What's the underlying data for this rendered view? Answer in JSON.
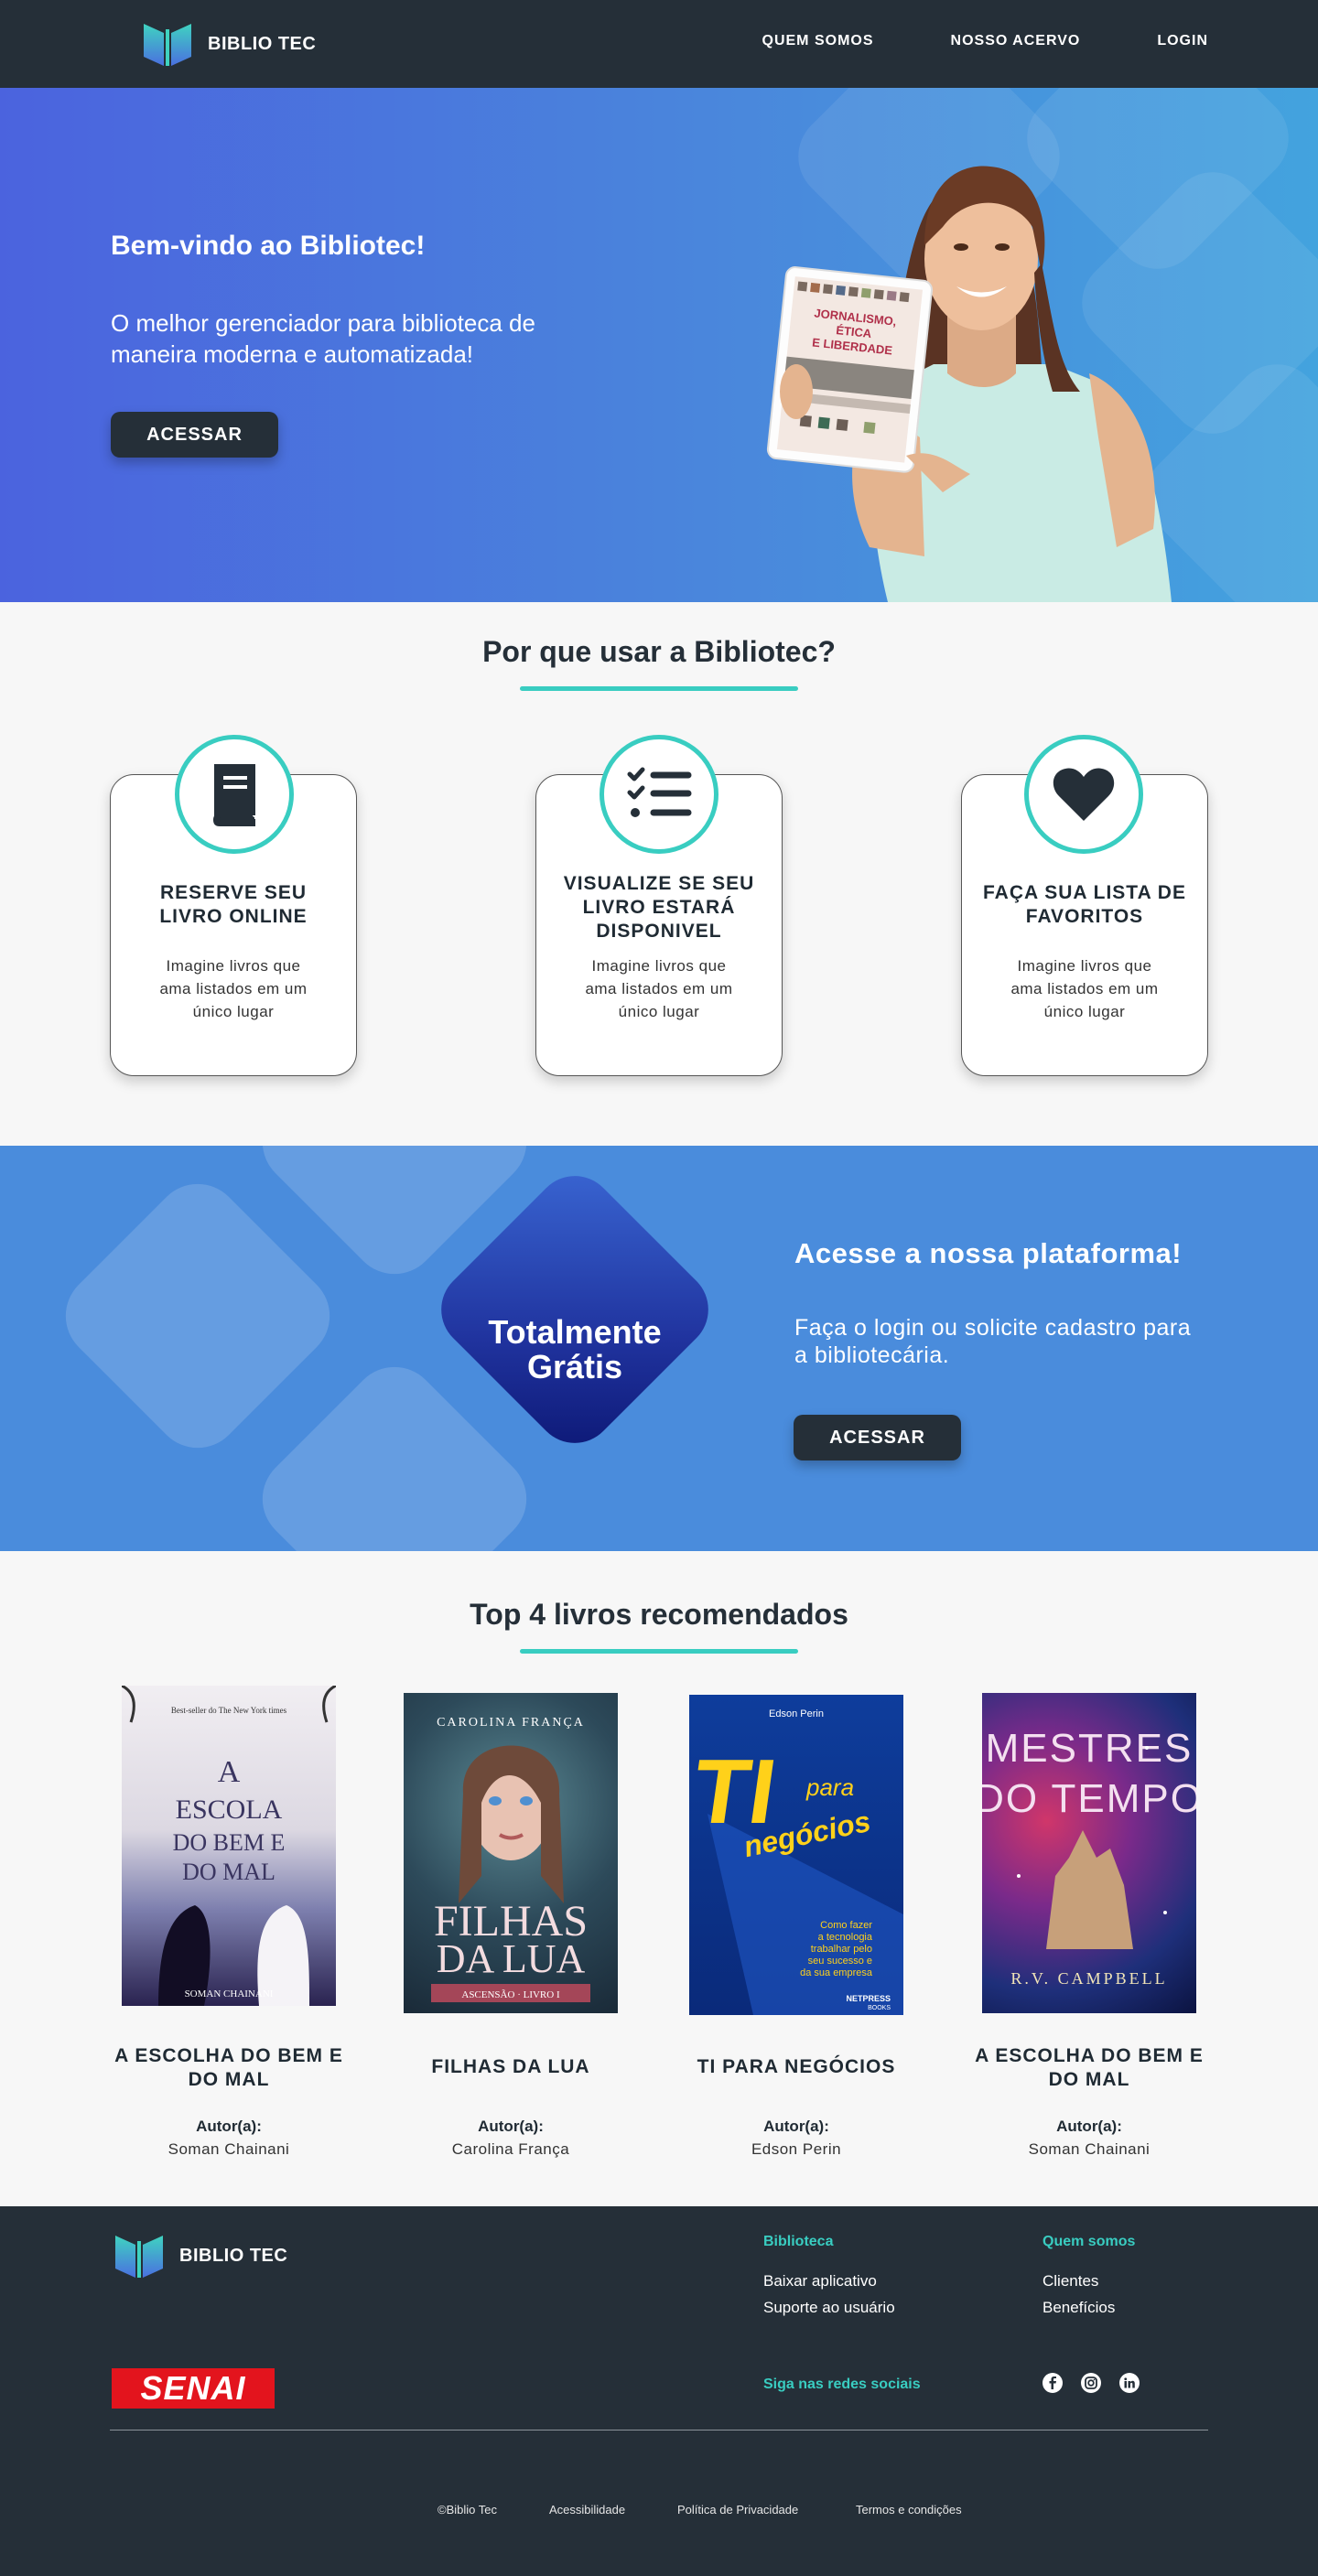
{
  "nav": {
    "logo_text": "BIBLIO TEC",
    "links": [
      "QUEM SOMOS",
      "NOSSO ACERVO",
      "LOGIN"
    ]
  },
  "hero": {
    "title": "Bem-vindo ao Bibliotec!",
    "subtitle": "O melhor gerenciador para biblioteca de maneira moderna e automatizada!",
    "button": "ACESSAR",
    "tablet_book": "JORNALISMO, ÉTICA E LIBERDADE"
  },
  "why": {
    "title": "Por que usar a Bibliotec?",
    "cards": [
      {
        "icon": "book-icon",
        "title": "RESERVE SEU LIVRO ONLINE",
        "text": "Imagine livros que ama listados em um único lugar"
      },
      {
        "icon": "checklist-icon",
        "title": "VISUALIZE SE SEU LIVRO ESTARÁ DISPONIVEL",
        "text": "Imagine livros que ama listados em um único lugar"
      },
      {
        "icon": "heart-icon",
        "title": "FAÇA SUA LISTA DE FAVORITOS",
        "text": "Imagine livros que ama listados em um único lugar"
      }
    ]
  },
  "promo": {
    "badge": "Totalmente Grátis",
    "title": "Acesse a nossa plataforma!",
    "subtitle": "Faça o login ou solicite cadastro para a bibliotecária.",
    "button": "ACESSAR"
  },
  "books": {
    "title": "Top 4 livros recomendados",
    "author_label": "Autor(a):",
    "items": [
      {
        "title": "A ESCOLHA DO BEM E DO MAL",
        "author": "Soman Chainani",
        "cover_title": "A ESCOLA DO BEM E DO MAL",
        "cover_top": "Best-seller do The New York times",
        "cover_author": "SOMAN CHAINANI"
      },
      {
        "title": "FILHAS DA LUA",
        "author": "Carolina França",
        "cover_title": "FILHAS DA LUA",
        "cover_top": "CAROLINA FRANÇA",
        "cover_author": "ASCENSÃO · LIVRO I"
      },
      {
        "title": "TI PARA NEGÓCIOS",
        "author": "Edson Perin",
        "cover_title": "TI para negócios",
        "cover_top": "Edson Perin",
        "cover_author": "Como fazer a tecnologia trabalhar pelo seu sucesso e da sua empresa"
      },
      {
        "title": "A ESCOLHA DO BEM E DO MAL",
        "author": "Soman Chainani",
        "cover_title": "MESTRES DO TEMPO",
        "cover_top": "",
        "cover_author": "R.V. CAMPBELL"
      }
    ]
  },
  "footer": {
    "logo_text": "BIBLIO TEC",
    "col1_title": "Biblioteca",
    "col1_links": [
      "Baixar aplicativo",
      "Suporte ao usuário"
    ],
    "col2_title": "Quem somos",
    "col2_links": [
      "Clientes",
      "Benefícios"
    ],
    "social_title": "Siga nas redes sociais",
    "senai": "SENAI",
    "bottom_links": [
      "©Biblio Tec",
      "Acessibilidade",
      "Política de Privacidade",
      "Termos e condições"
    ]
  },
  "colors": {
    "accent": "#39cdc1",
    "dark": "#252f38",
    "blue": "#4a8cdc"
  }
}
